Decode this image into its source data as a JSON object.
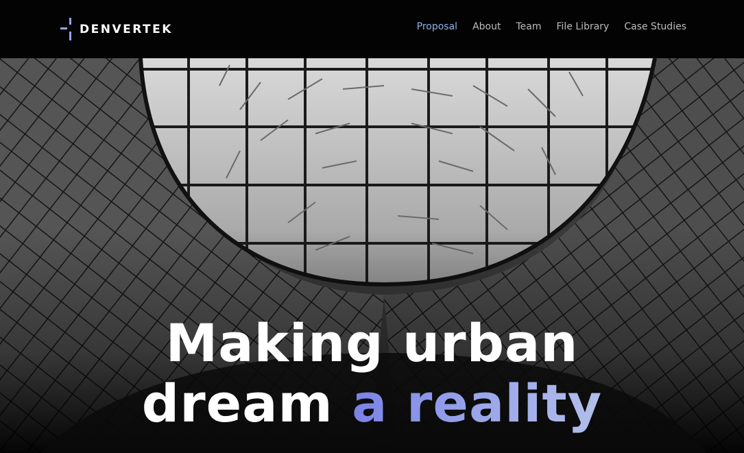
{
  "brand": {
    "name": "DENVERTEK",
    "accent_color": "#8fa6e6"
  },
  "nav": {
    "items": [
      {
        "label": "Proposal",
        "active": true
      },
      {
        "label": "About",
        "active": false
      },
      {
        "label": "Team",
        "active": false
      },
      {
        "label": "File Library",
        "active": false
      },
      {
        "label": "Case Studies",
        "active": false
      }
    ],
    "active_color": "#8fb2e8"
  },
  "hero": {
    "line1": "Making urban",
    "line2_plain": "dream",
    "line2_accent": "a reality",
    "accent_gradient": [
      "#7a82e6",
      "#b2bfe9"
    ]
  }
}
